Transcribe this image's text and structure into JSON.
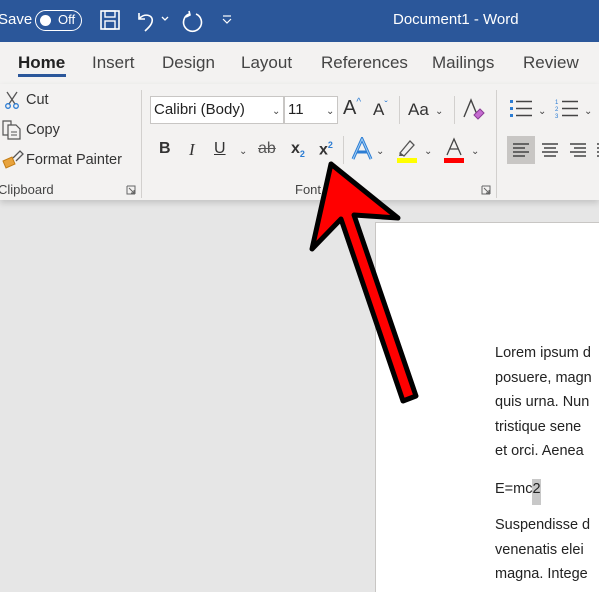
{
  "titlebar": {
    "autosave_label": "Save",
    "autosave_state": "Off",
    "title": "Document1  -  Word",
    "bg_color": "#2b579a"
  },
  "tabs": [
    {
      "label": "Home",
      "active": true
    },
    {
      "label": "Insert"
    },
    {
      "label": "Design"
    },
    {
      "label": "Layout"
    },
    {
      "label": "References"
    },
    {
      "label": "Mailings"
    },
    {
      "label": "Review"
    }
  ],
  "clipboard": {
    "cut": "Cut",
    "copy": "Copy",
    "format_painter": "Format Painter",
    "group_label": "Clipboard"
  },
  "font": {
    "font_name": "Calibri (Body)",
    "font_size": "11",
    "case_label": "Aa",
    "group_label": "Font",
    "bold": "B",
    "italic": "I",
    "underline": "U",
    "strikethrough": "ab",
    "highlight_color": "#ffff00",
    "font_color": "#ff0000"
  },
  "document": {
    "lines": [
      "Lorem ipsum d",
      "posuere, magn",
      "quis urna. Nun",
      "tristique sene",
      "et orci. Aenea"
    ],
    "equation_base": "E=mc",
    "equation_selected": "2",
    "lines2": [
      "Suspendisse d",
      "venenatis elei",
      "magna. Intege"
    ]
  },
  "annotation": {
    "arrow_color": "#ff0000",
    "points_to": "superscript-button"
  }
}
